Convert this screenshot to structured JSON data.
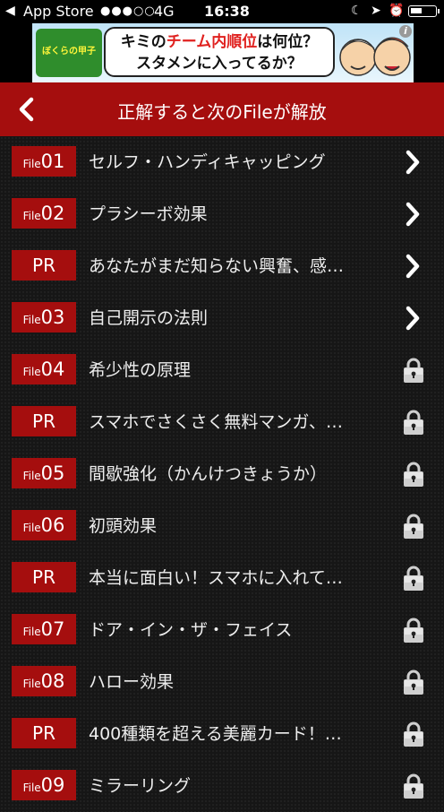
{
  "status_bar": {
    "back_label": "◀",
    "app_store": "App Store",
    "signal": "●●●○○",
    "network": "4G",
    "time": "16:38",
    "moon_icon": "☾",
    "location_icon": "➤",
    "alarm_icon": "⏰"
  },
  "ad": {
    "logo_text": "ぼくらの甲子園!",
    "line1_a": "キミの",
    "line1_red": "チーム内順位",
    "line1_b": "は何位？",
    "line2": "スタメンに入ってるか？",
    "info_icon": "i"
  },
  "nav": {
    "title": "正解すると次のFileが解放"
  },
  "rows": [
    {
      "type": "file",
      "prefix": "File",
      "num": "01",
      "label": "セルフ・ハンディキャッピング",
      "icon": "chevron-right"
    },
    {
      "type": "file",
      "prefix": "File",
      "num": "02",
      "label": "プラシーボ効果",
      "icon": "chevron-right"
    },
    {
      "type": "pr",
      "badge": "PR",
      "label": "あなたがまだ知らない興奮、感…",
      "icon": "chevron-right"
    },
    {
      "type": "file",
      "prefix": "File",
      "num": "03",
      "label": "自己開示の法則",
      "icon": "chevron-right"
    },
    {
      "type": "file",
      "prefix": "File",
      "num": "04",
      "label": "希少性の原理",
      "icon": "lock"
    },
    {
      "type": "pr",
      "badge": "PR",
      "label": "スマホでさくさく無料マンガ、…",
      "icon": "lock"
    },
    {
      "type": "file",
      "prefix": "File",
      "num": "05",
      "label": "間歇強化（かんけつきょうか）",
      "icon": "lock"
    },
    {
      "type": "file",
      "prefix": "File",
      "num": "06",
      "label": "初頭効果",
      "icon": "lock"
    },
    {
      "type": "pr",
      "badge": "PR",
      "label": "本当に面白い！スマホに入れて…",
      "icon": "lock"
    },
    {
      "type": "file",
      "prefix": "File",
      "num": "07",
      "label": "ドア・イン・ザ・フェイス",
      "icon": "lock"
    },
    {
      "type": "file",
      "prefix": "File",
      "num": "08",
      "label": "ハロー効果",
      "icon": "lock"
    },
    {
      "type": "pr",
      "badge": "PR",
      "label": "400種類を超える美麗カード！…",
      "icon": "lock"
    },
    {
      "type": "file",
      "prefix": "File",
      "num": "09",
      "label": "ミラーリング",
      "icon": "lock"
    }
  ],
  "colors": {
    "accent_red": "#a50e0e",
    "background": "#161616"
  }
}
